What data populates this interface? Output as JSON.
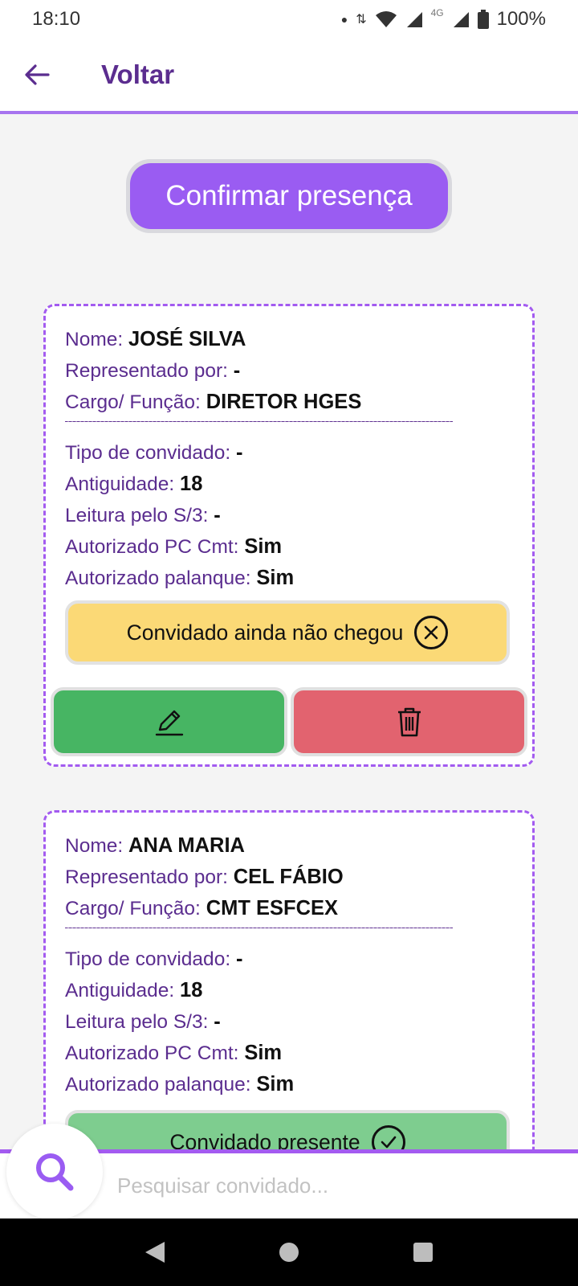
{
  "status_bar": {
    "time": "18:10",
    "network": "4G",
    "battery": "100%"
  },
  "app_bar": {
    "title": "Voltar",
    "back_icon": "arrow-left-icon"
  },
  "confirm_button": {
    "label": "Confirmar presença"
  },
  "guests": [
    {
      "nome_label": "Nome:",
      "nome": "JOSÉ SILVA",
      "representado_label": "Representado por:",
      "representado": "-",
      "cargo_label": "Cargo/ Função:",
      "cargo": "DIRETOR HGES",
      "divider": "--------------------------------------------------------------------",
      "tipo_label": "Tipo de convidado:",
      "tipo": "-",
      "antiguidade_label": "Antiguidade:",
      "antiguidade": "18",
      "leitura_label": "Leitura pelo S/3:",
      "leitura": "-",
      "autorizado_pc_label": "Autorizado PC Cmt:",
      "autorizado_pc": "Sim",
      "autorizado_palanque_label": "Autorizado palanque:",
      "autorizado_palanque": "Sim",
      "status": "Convidado ainda não chegou",
      "status_icon": "x-circle-icon",
      "status_color": "#fbd976"
    },
    {
      "nome_label": "Nome:",
      "nome": "ANA MARIA",
      "representado_label": "Representado por:",
      "representado": "CEL FÁBIO",
      "cargo_label": "Cargo/ Função:",
      "cargo": "CMT ESFCEX",
      "divider": "--------------------------------------------------------------------",
      "tipo_label": "Tipo de convidado:",
      "tipo": "-",
      "antiguidade_label": "Antiguidade:",
      "antiguidade": "18",
      "leitura_label": "Leitura pelo S/3:",
      "leitura": "-",
      "autorizado_pc_label": "Autorizado PC Cmt:",
      "autorizado_pc": "Sim",
      "autorizado_palanque_label": "Autorizado palanque:",
      "autorizado_palanque": "Sim",
      "status": "Convidado presente",
      "status_icon": "check-circle-icon",
      "status_color": "#7ecd8f"
    }
  ],
  "actions": {
    "edit_icon": "pencil-icon",
    "delete_icon": "trash-icon",
    "edit_color": "#47b563",
    "delete_color": "#e2636f"
  },
  "search": {
    "placeholder": "Pesquisar convidado...",
    "value": "",
    "icon": "search-icon"
  },
  "colors": {
    "accent": "#9a5cf2",
    "title": "#5b2d8f"
  }
}
